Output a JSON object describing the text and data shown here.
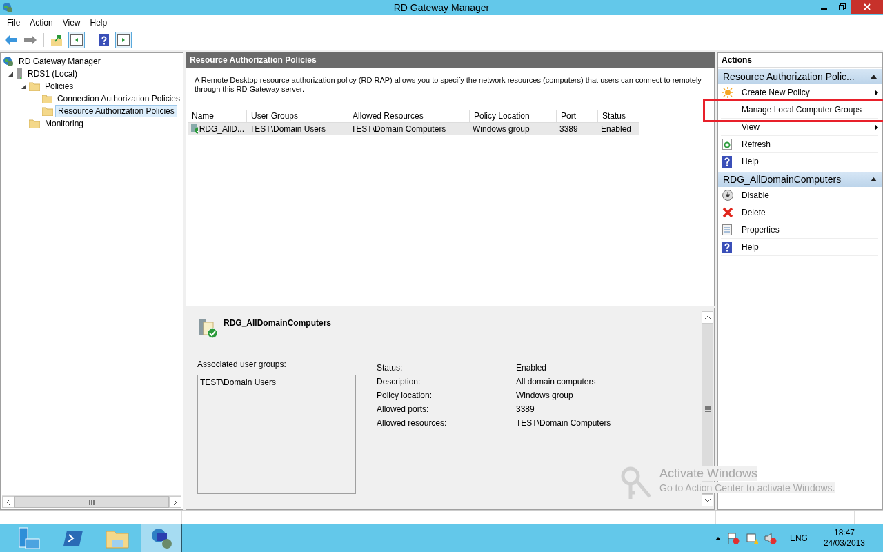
{
  "window": {
    "title": "RD Gateway Manager"
  },
  "menu": [
    "File",
    "Action",
    "View",
    "Help"
  ],
  "tree": [
    {
      "label": "RD Gateway Manager",
      "kind": "gateway",
      "selected": false,
      "children": [
        {
          "label": "RDS1 (Local)",
          "kind": "server",
          "expanded": true,
          "selected": false,
          "children": [
            {
              "label": "Policies",
              "kind": "folder",
              "expanded": true,
              "selected": false,
              "children": [
                {
                  "label": "Connection Authorization Policies",
                  "kind": "folder",
                  "selected": false
                },
                {
                  "label": "Resource Authorization Policies",
                  "kind": "folder",
                  "selected": true
                }
              ]
            },
            {
              "label": "Monitoring",
              "kind": "folder",
              "selected": false
            }
          ]
        }
      ]
    }
  ],
  "center": {
    "title": "Resource Authorization Policies",
    "description": "A Remote Desktop resource authorization policy (RD RAP) allows you to specify the network resources (computers) that users can connect to remotely through this RD Gateway server.",
    "table": {
      "columns": [
        "Name",
        "User Groups",
        "Allowed Resources",
        "Policy Location",
        "Port",
        "Status"
      ],
      "rows": [
        {
          "selected": true,
          "cells": [
            "RDG_AllD...",
            "TEST\\Domain Users",
            "TEST\\Domain Computers",
            "Windows group",
            "3389",
            "Enabled"
          ]
        }
      ]
    },
    "details": {
      "title": "RDG_AllDomainComputers",
      "groups_label": "Associated user groups:",
      "groups": [
        "TEST\\Domain Users"
      ],
      "properties": [
        {
          "label": "Status:",
          "value": "Enabled"
        },
        {
          "label": "Description:",
          "value": "All domain computers"
        },
        {
          "label": "Policy location:",
          "value": "Windows group"
        },
        {
          "label": "Allowed ports:",
          "value": "3389"
        },
        {
          "label": "Allowed resources:",
          "value": "TEST\\Domain Computers"
        }
      ]
    }
  },
  "actions": {
    "title": "Actions",
    "sections": [
      {
        "title": "Resource Authorization Polic...",
        "expanded": true,
        "items": [
          {
            "label": "Create New Policy",
            "kind": "star",
            "submenu": true,
            "highlighted": false
          },
          {
            "label": "Manage Local Computer Groups",
            "kind": "plain",
            "submenu": false,
            "highlighted": true
          },
          {
            "label": "View",
            "kind": "plain",
            "submenu": true,
            "highlighted": false
          },
          {
            "label": "Refresh",
            "kind": "refresh",
            "submenu": false,
            "highlighted": false
          },
          {
            "label": "Help",
            "kind": "help",
            "submenu": false,
            "highlighted": false
          }
        ]
      },
      {
        "title": "RDG_AllDomainComputers",
        "expanded": true,
        "items": [
          {
            "label": "Disable",
            "kind": "disable",
            "submenu": false,
            "highlighted": false
          },
          {
            "label": "Delete",
            "kind": "delete",
            "submenu": false,
            "highlighted": false
          },
          {
            "label": "Properties",
            "kind": "properties",
            "submenu": false,
            "highlighted": false
          },
          {
            "label": "Help",
            "kind": "help",
            "submenu": false,
            "highlighted": false
          }
        ]
      }
    ]
  },
  "activation": {
    "title": "Activate Windows",
    "hint": "Go to Action Center to activate Windows."
  },
  "taskbar": {
    "apps": [
      {
        "kind": "server-manager",
        "selected": false
      },
      {
        "kind": "powershell",
        "selected": false
      },
      {
        "kind": "explorer",
        "selected": false
      },
      {
        "kind": "gateway",
        "selected": true
      }
    ],
    "language": "ENG",
    "time": "18:47",
    "date": "24/03/2013"
  }
}
